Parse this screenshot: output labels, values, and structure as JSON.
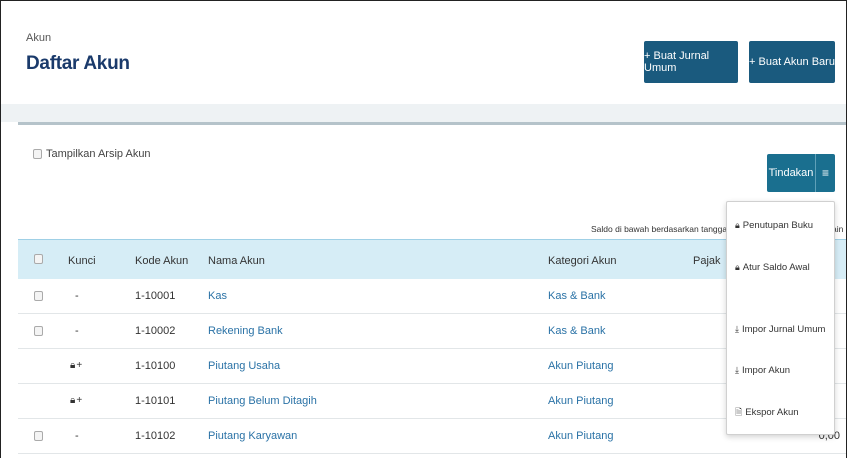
{
  "header": {
    "breadcrumb": "Akun",
    "title": "Daftar Akun",
    "btn_jurnal": "+ Buat Jurnal Umum",
    "btn_akun": "+ Buat Akun Baru"
  },
  "filter": {
    "arsip_label": "Tampilkan Arsip Akun"
  },
  "actions": {
    "tindakan": "Tindakan",
    "menu_icon": "≡"
  },
  "saldo_note": "Saldo di bawah berdasarkan tanggal 02",
  "saldo_note_tail": "ain",
  "table": {
    "headers": {
      "kunci": "Kunci",
      "kode": "Kode Akun",
      "nama": "Nama Akun",
      "kategori": "Kategori Akun",
      "pajak": "Pajak"
    },
    "rows": [
      {
        "locked": false,
        "kunci": "-",
        "kode": "1-10001",
        "nama": "Kas",
        "kategori": "Kas & Bank",
        "saldo": ""
      },
      {
        "locked": false,
        "kunci": "-",
        "kode": "1-10002",
        "nama": "Rekening Bank",
        "kategori": "Kas & Bank",
        "saldo": ""
      },
      {
        "locked": true,
        "kunci": "🔒+",
        "kode": "1-10100",
        "nama": "Piutang Usaha",
        "kategori": "Akun Piutang",
        "saldo": ""
      },
      {
        "locked": true,
        "kunci": "🔒+",
        "kode": "1-10101",
        "nama": "Piutang Belum Ditagih",
        "kategori": "Akun Piutang",
        "saldo": ""
      },
      {
        "locked": false,
        "kunci": "-",
        "kode": "1-10102",
        "nama": "Piutang Karyawan",
        "kategori": "Akun Piutang",
        "saldo": "0,00"
      }
    ]
  },
  "dropdown": {
    "items": [
      {
        "icon": "lock-icon",
        "label": "Penutupan Buku"
      },
      {
        "icon": "lock-icon",
        "label": "Atur Saldo Awal"
      },
      {
        "icon": "download-icon",
        "label": "Impor Jurnal Umum"
      },
      {
        "icon": "download-icon",
        "label": "Impor Akun"
      },
      {
        "icon": "file-icon",
        "label": "Ekspor Akun"
      }
    ]
  },
  "colors": {
    "primary_button": "#1a5a7e",
    "tindakan_button": "#1a6f8f",
    "link": "#2a72a6",
    "table_header": "#d6edf6",
    "title": "#1a3a6b"
  }
}
